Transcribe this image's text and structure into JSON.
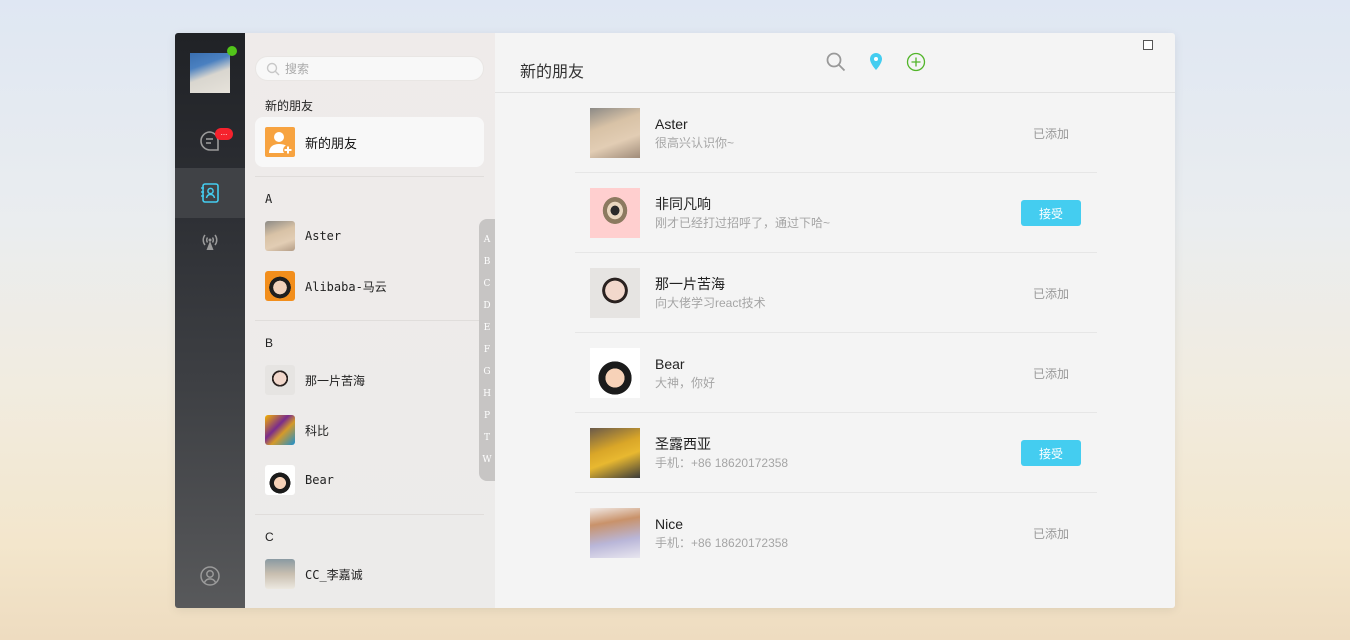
{
  "colors": {
    "accent": "#44cdf0",
    "online": "#52c41a",
    "badge": "#f5222d",
    "new_friend_icon_bg": "#f7a340"
  },
  "nav": {
    "items": [
      {
        "name": "chat",
        "icon": "chat-bubble-icon",
        "badge": "..."
      },
      {
        "name": "contacts",
        "icon": "address-book-icon",
        "active": true
      },
      {
        "name": "moments",
        "icon": "broadcast-icon"
      }
    ],
    "bottom_icon": "user-circle-icon"
  },
  "contacts_panel": {
    "search_placeholder": "搜索",
    "new_friends_section": "新的朋友",
    "new_friends_label": "新的朋友",
    "groups": [
      {
        "letter": "A",
        "contacts": [
          {
            "name": "Aster"
          },
          {
            "name": "Alibaba-马云"
          }
        ]
      },
      {
        "letter": "B",
        "contacts": [
          {
            "name": "那一片苦海"
          },
          {
            "name": "科比"
          },
          {
            "name": "Bear"
          }
        ]
      },
      {
        "letter": "C",
        "contacts": [
          {
            "name": "CC_李嘉诚"
          }
        ]
      }
    ],
    "index_letters": [
      "A",
      "B",
      "C",
      "D",
      "E",
      "F",
      "G",
      "H",
      "P",
      "T",
      "W"
    ]
  },
  "main": {
    "title": "新的朋友",
    "toolbar": [
      "search-icon",
      "location-pin-icon",
      "add-circle-icon"
    ],
    "requests": [
      {
        "name": "Aster",
        "message": "很高兴认识你~",
        "status": "已添加",
        "accepted": true
      },
      {
        "name": "非同凡响",
        "message": "刚才已经打过招呼了，通过下哈~",
        "status": "接受",
        "accepted": false
      },
      {
        "name": "那一片苦海",
        "message": "向大佬学习react技术",
        "status": "已添加",
        "accepted": true
      },
      {
        "name": "Bear",
        "message": "大神，你好",
        "status": "已添加",
        "accepted": true
      },
      {
        "name": "圣露西亚",
        "message": "手机：+86 18620172358",
        "status": "接受",
        "accepted": false
      },
      {
        "name": "Nice",
        "message": "手机：+86 18620172358",
        "status": "已添加",
        "accepted": true
      }
    ]
  }
}
